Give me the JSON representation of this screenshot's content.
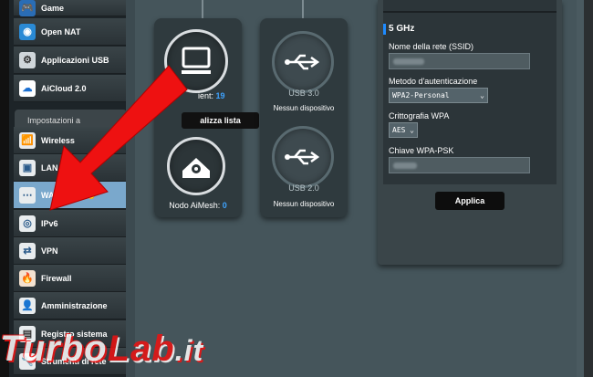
{
  "sidebar": {
    "top_items": [
      {
        "label": "Game",
        "icon": "gamepad-icon"
      },
      {
        "label": "Open NAT",
        "icon": "globe-icon"
      },
      {
        "label": "Applicazioni USB",
        "icon": "usb-apps-icon"
      },
      {
        "label": "AiCloud 2.0",
        "icon": "cloud-icon"
      }
    ],
    "section_title": "Impostazioni a",
    "items": [
      {
        "label": "Wireless",
        "icon": "wireless-icon"
      },
      {
        "label": "LAN",
        "icon": "lan-icon"
      },
      {
        "label": "WAN",
        "icon": "wan-icon"
      },
      {
        "label": "IPv6",
        "icon": "ipv6-icon"
      },
      {
        "label": "VPN",
        "icon": "vpn-icon"
      },
      {
        "label": "Firewall",
        "icon": "firewall-icon"
      },
      {
        "label": "Amministrazione",
        "icon": "admin-icon"
      },
      {
        "label": "Registro sistema",
        "icon": "log-icon"
      },
      {
        "label": "Strumenti di rete",
        "icon": "tools-icon"
      }
    ],
    "active_color": "#7aa8cc"
  },
  "network_map": {
    "clients_label": "ient:",
    "clients_count": "19",
    "view_list_button": "alizza lista",
    "aimesh_label": "Nodo AiMesh:",
    "aimesh_count": "0",
    "usb30_title": "USB 3.0",
    "usb30_status": "Nessun dispositivo",
    "usb20_title": "USB 2.0",
    "usb20_status": "Nessun dispositivo"
  },
  "wireless_panel": {
    "band_title": "5 GHz",
    "ssid_label": "Nome della rete (SSID)",
    "auth_label": "Metodo d'autenticazione",
    "auth_value": "WPA2-Personal",
    "encryption_label": "Crittografia WPA",
    "encryption_value": "AES",
    "psk_label": "Chiave WPA-PSK",
    "apply_button": "Applica"
  },
  "watermark": {
    "part1": "Turbo",
    "part2": "Lab",
    "part3": ".it"
  },
  "colors": {
    "accent_blue": "#3ea3ff",
    "arrow_red": "#ee1111"
  }
}
